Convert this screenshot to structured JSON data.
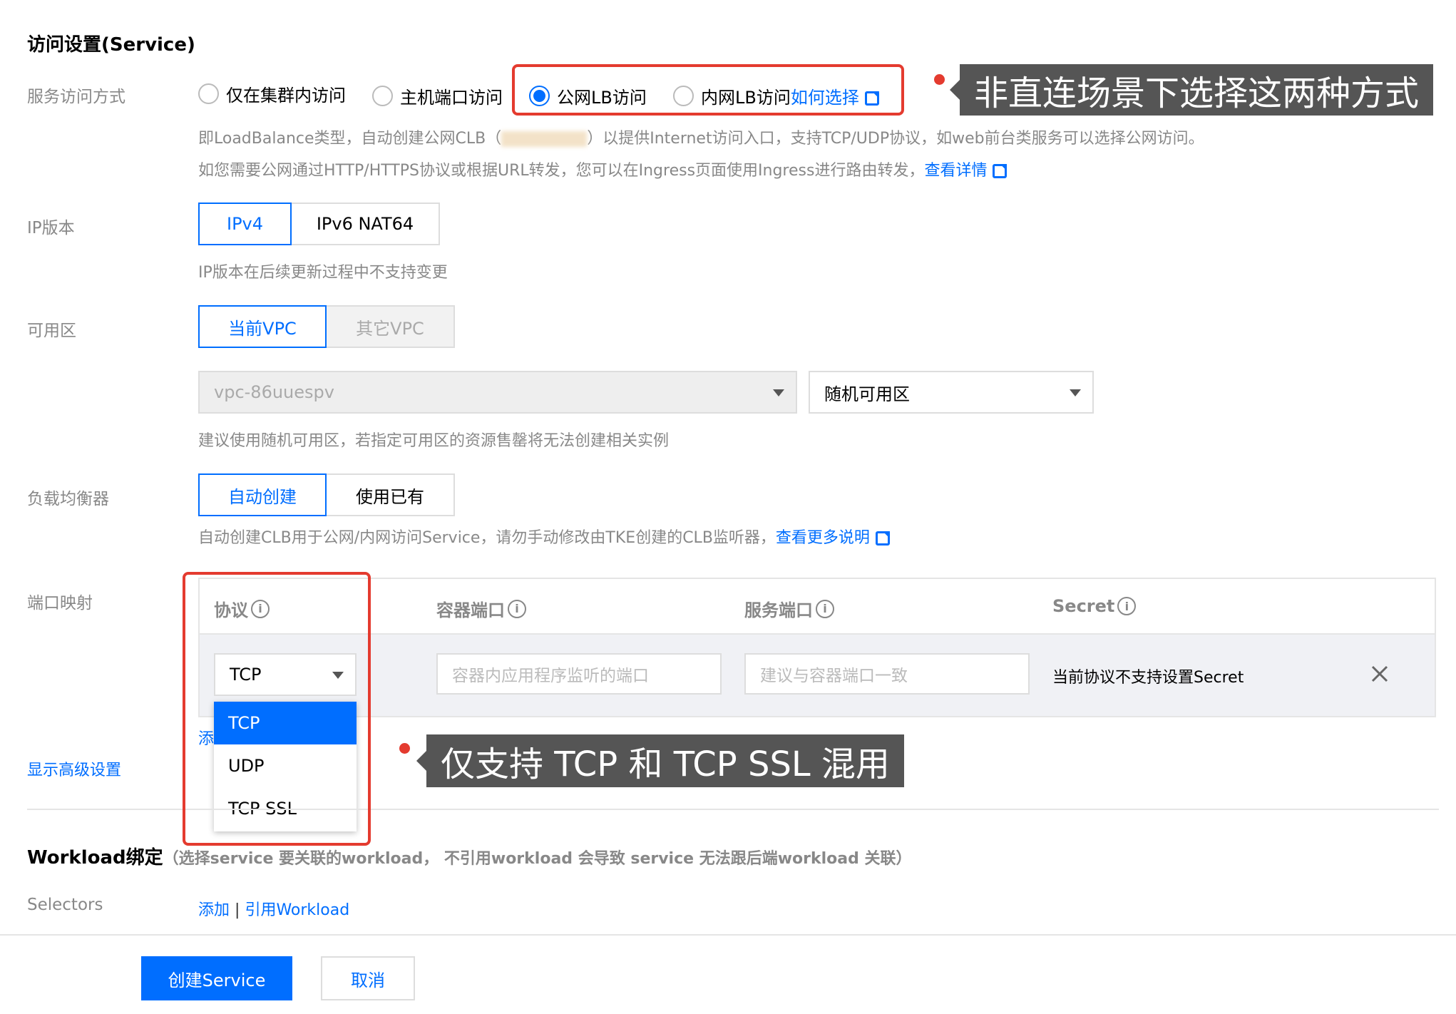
{
  "section_service": {
    "title": "访问设置(Service)"
  },
  "access_mode": {
    "label": "服务访问方式",
    "options": [
      "仅在集群内访问",
      "主机端口访问",
      "公网LB访问",
      "内网LB访问"
    ],
    "selected": "公网LB访问",
    "help_link": "如何选择",
    "desc1_pre": "即LoadBalance类型，自动创建公网CLB（",
    "desc1_post": "）以提供Internet访问入口，支持TCP/UDP协议，如web前台类服务可以选择公网访问。",
    "desc2": "如您需要公网通过HTTP/HTTPS协议或根据URL转发，您可以在Ingress页面使用Ingress进行路由转发，",
    "desc2_link": "查看详情"
  },
  "ip_version": {
    "label": "IP版本",
    "options": [
      "IPv4",
      "IPv6 NAT64"
    ],
    "selected": "IPv4",
    "hint": "IP版本在后续更新过程中不支持变更"
  },
  "zone": {
    "label": "可用区",
    "options": [
      "当前VPC",
      "其它VPC"
    ],
    "selected": "当前VPC",
    "vpc_value": "vpc-86uuespv",
    "zone_value": "随机可用区",
    "hint": "建议使用随机可用区，若指定可用区的资源售罄将无法创建相关实例"
  },
  "load_balancer": {
    "label": "负载均衡器",
    "options": [
      "自动创建",
      "使用已有"
    ],
    "selected": "自动创建",
    "hint": "自动创建CLB用于公网/内网访问Service，请勿手动修改由TKE创建的CLB监听器，",
    "hint_link": "查看更多说明"
  },
  "port_mapping": {
    "label": "端口映射",
    "columns": [
      "协议",
      "容器端口",
      "服务端口",
      "Secret"
    ],
    "protocol_value": "TCP",
    "container_port_placeholder": "容器内应用程序监听的端口",
    "service_port_placeholder": "建议与容器端口一致",
    "secret_text": "当前协议不支持设置Secret",
    "add_link_partial": "添",
    "dropdown_options": [
      "TCP",
      "UDP",
      "TCP SSL"
    ]
  },
  "advanced_link": "显示高级设置",
  "workload": {
    "title": "Workload绑定",
    "note": "（选择service 要关联的workload， 不引用workload 会导致 service 无法跟后端workload 关联）",
    "selectors_label": "Selectors",
    "add_link": "添加",
    "separator": "|",
    "ref_link": "引用Workload"
  },
  "footer": {
    "create_button": "创建Service",
    "cancel_button": "取消"
  },
  "annotations": {
    "callout1": "非直连场景下选择这两种方式",
    "callout2": "仅支持 TCP 和 TCP SSL 混用"
  },
  "colors": {
    "accent": "#006eff",
    "annotation_red": "#e43b2f",
    "callout_bg": "#555555"
  }
}
